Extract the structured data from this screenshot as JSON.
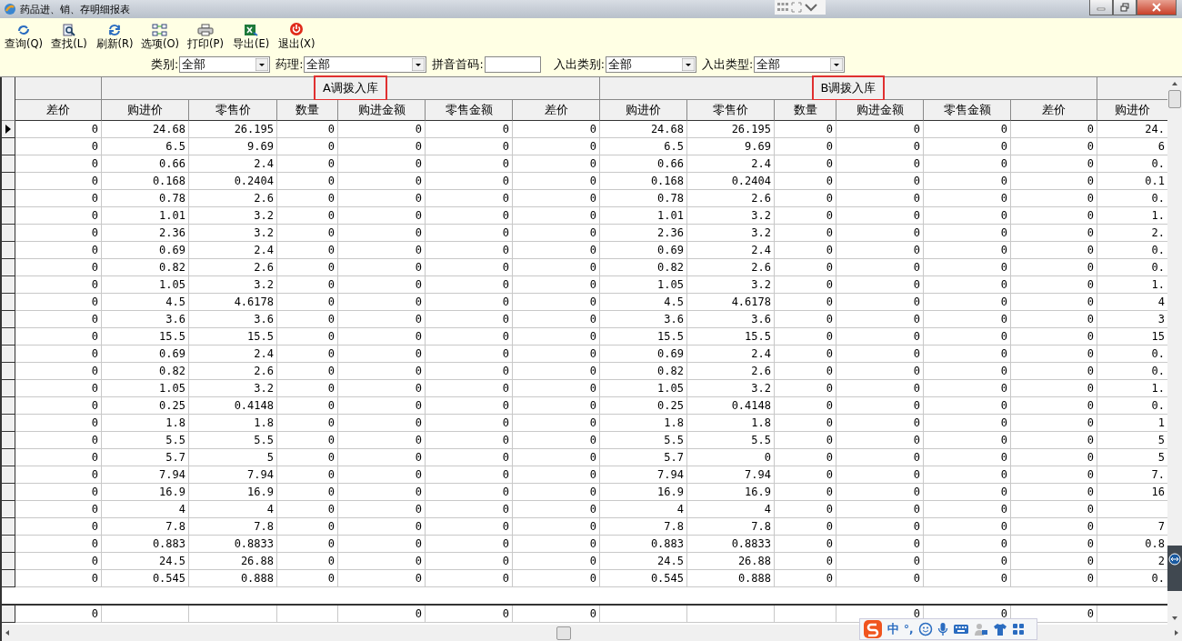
{
  "window": {
    "title": "药品进、销、存明细报表"
  },
  "toolbar": [
    {
      "label": "查询(Q)",
      "kind": "query"
    },
    {
      "label": "查找(L)",
      "kind": "find"
    },
    {
      "label": "刷新(R)",
      "kind": "refresh"
    },
    {
      "label": "选项(O)",
      "kind": "options"
    },
    {
      "label": "打印(P)",
      "kind": "print"
    },
    {
      "label": "导出(E)",
      "kind": "export"
    },
    {
      "label": "退出(X)",
      "kind": "exit"
    }
  ],
  "filters": [
    {
      "label": "类别:",
      "kind": "dropdown",
      "value": "全部"
    },
    {
      "label": "药理:",
      "kind": "dropdown",
      "value": "全部"
    },
    {
      "label": "拼音首码:",
      "kind": "text"
    },
    {
      "label": "入出类别:",
      "kind": "dropdown",
      "value": "全部"
    },
    {
      "label": "入出类型:",
      "kind": "dropdown",
      "value": "全部"
    }
  ],
  "table": {
    "groups": [
      {
        "highlighted": false,
        "columns": [
          "差价"
        ]
      },
      {
        "label": "A调拨入库",
        "highlighted": true,
        "columns": [
          "购进价",
          "零售价",
          "数量",
          "购进金额",
          "零售金额",
          "差价"
        ]
      },
      {
        "label": "B调拨入库",
        "highlighted": true,
        "columns": [
          "购进价",
          "零售价",
          "数量",
          "购进金额",
          "零售金额",
          "差价"
        ]
      },
      {
        "highlighted": false,
        "columns": [
          "购进价"
        ]
      }
    ],
    "rows": [
      {
        "selected": true,
        "cells": [
          "0",
          "24.68",
          "26.195",
          "0",
          "0",
          "0",
          "0",
          "24.68",
          "26.195",
          "0",
          "0",
          "0",
          "0",
          "24."
        ]
      },
      {
        "selected": false,
        "cells": [
          "0",
          "6.5",
          "9.69",
          "0",
          "0",
          "0",
          "0",
          "6.5",
          "9.69",
          "0",
          "0",
          "0",
          "0",
          "6"
        ]
      },
      {
        "selected": false,
        "cells": [
          "0",
          "0.66",
          "2.4",
          "0",
          "0",
          "0",
          "0",
          "0.66",
          "2.4",
          "0",
          "0",
          "0",
          "0",
          "0."
        ]
      },
      {
        "selected": false,
        "cells": [
          "0",
          "0.168",
          "0.2404",
          "0",
          "0",
          "0",
          "0",
          "0.168",
          "0.2404",
          "0",
          "0",
          "0",
          "0",
          "0.1"
        ]
      },
      {
        "selected": false,
        "cells": [
          "0",
          "0.78",
          "2.6",
          "0",
          "0",
          "0",
          "0",
          "0.78",
          "2.6",
          "0",
          "0",
          "0",
          "0",
          "0."
        ]
      },
      {
        "selected": false,
        "cells": [
          "0",
          "1.01",
          "3.2",
          "0",
          "0",
          "0",
          "0",
          "1.01",
          "3.2",
          "0",
          "0",
          "0",
          "0",
          "1."
        ]
      },
      {
        "selected": false,
        "cells": [
          "0",
          "2.36",
          "3.2",
          "0",
          "0",
          "0",
          "0",
          "2.36",
          "3.2",
          "0",
          "0",
          "0",
          "0",
          "2."
        ]
      },
      {
        "selected": false,
        "cells": [
          "0",
          "0.69",
          "2.4",
          "0",
          "0",
          "0",
          "0",
          "0.69",
          "2.4",
          "0",
          "0",
          "0",
          "0",
          "0."
        ]
      },
      {
        "selected": false,
        "cells": [
          "0",
          "0.82",
          "2.6",
          "0",
          "0",
          "0",
          "0",
          "0.82",
          "2.6",
          "0",
          "0",
          "0",
          "0",
          "0."
        ]
      },
      {
        "selected": false,
        "cells": [
          "0",
          "1.05",
          "3.2",
          "0",
          "0",
          "0",
          "0",
          "1.05",
          "3.2",
          "0",
          "0",
          "0",
          "0",
          "1."
        ]
      },
      {
        "selected": false,
        "cells": [
          "0",
          "4.5",
          "4.6178",
          "0",
          "0",
          "0",
          "0",
          "4.5",
          "4.6178",
          "0",
          "0",
          "0",
          "0",
          "4"
        ]
      },
      {
        "selected": false,
        "cells": [
          "0",
          "3.6",
          "3.6",
          "0",
          "0",
          "0",
          "0",
          "3.6",
          "3.6",
          "0",
          "0",
          "0",
          "0",
          "3"
        ]
      },
      {
        "selected": false,
        "cells": [
          "0",
          "15.5",
          "15.5",
          "0",
          "0",
          "0",
          "0",
          "15.5",
          "15.5",
          "0",
          "0",
          "0",
          "0",
          "15"
        ]
      },
      {
        "selected": false,
        "cells": [
          "0",
          "0.69",
          "2.4",
          "0",
          "0",
          "0",
          "0",
          "0.69",
          "2.4",
          "0",
          "0",
          "0",
          "0",
          "0."
        ]
      },
      {
        "selected": false,
        "cells": [
          "0",
          "0.82",
          "2.6",
          "0",
          "0",
          "0",
          "0",
          "0.82",
          "2.6",
          "0",
          "0",
          "0",
          "0",
          "0."
        ]
      },
      {
        "selected": false,
        "cells": [
          "0",
          "1.05",
          "3.2",
          "0",
          "0",
          "0",
          "0",
          "1.05",
          "3.2",
          "0",
          "0",
          "0",
          "0",
          "1."
        ]
      },
      {
        "selected": false,
        "cells": [
          "0",
          "0.25",
          "0.4148",
          "0",
          "0",
          "0",
          "0",
          "0.25",
          "0.4148",
          "0",
          "0",
          "0",
          "0",
          "0."
        ]
      },
      {
        "selected": false,
        "cells": [
          "0",
          "1.8",
          "1.8",
          "0",
          "0",
          "0",
          "0",
          "1.8",
          "1.8",
          "0",
          "0",
          "0",
          "0",
          "1"
        ]
      },
      {
        "selected": false,
        "cells": [
          "0",
          "5.5",
          "5.5",
          "0",
          "0",
          "0",
          "0",
          "5.5",
          "5.5",
          "0",
          "0",
          "0",
          "0",
          "5"
        ]
      },
      {
        "selected": false,
        "cells": [
          "0",
          "5.7",
          "5",
          "0",
          "0",
          "0",
          "0",
          "5.7",
          "0",
          "0",
          "0",
          "0",
          "0",
          "5"
        ]
      },
      {
        "selected": false,
        "cells": [
          "0",
          "7.94",
          "7.94",
          "0",
          "0",
          "0",
          "0",
          "7.94",
          "7.94",
          "0",
          "0",
          "0",
          "0",
          "7."
        ]
      },
      {
        "selected": false,
        "cells": [
          "0",
          "16.9",
          "16.9",
          "0",
          "0",
          "0",
          "0",
          "16.9",
          "16.9",
          "0",
          "0",
          "0",
          "0",
          "16"
        ]
      },
      {
        "selected": false,
        "cells": [
          "0",
          "4",
          "4",
          "0",
          "0",
          "0",
          "0",
          "4",
          "4",
          "0",
          "0",
          "0",
          "0"
        ]
      },
      {
        "selected": false,
        "cells": [
          "0",
          "7.8",
          "7.8",
          "0",
          "0",
          "0",
          "0",
          "7.8",
          "7.8",
          "0",
          "0",
          "0",
          "0",
          "7"
        ]
      },
      {
        "selected": false,
        "cells": [
          "0",
          "0.883",
          "0.8833",
          "0",
          "0",
          "0",
          "0",
          "0.883",
          "0.8833",
          "0",
          "0",
          "0",
          "0",
          "0.8"
        ]
      },
      {
        "selected": false,
        "cells": [
          "0",
          "24.5",
          "26.88",
          "0",
          "0",
          "0",
          "0",
          "24.5",
          "26.88",
          "0",
          "0",
          "0",
          "0",
          "2"
        ]
      },
      {
        "selected": false,
        "cells": [
          "0",
          "0.545",
          "0.888",
          "0",
          "0",
          "0",
          "0",
          "0.545",
          "0.888",
          "0",
          "0",
          "0",
          "0",
          "0."
        ]
      }
    ],
    "totals": {
      "column_1": "0",
      "column_5": "0",
      "column_6": "0",
      "column_7": "0",
      "column_11": "0",
      "column_12": "0",
      "column_13": "0"
    }
  },
  "ime_bar": {
    "mode": "中",
    "punctuation": "°,"
  }
}
